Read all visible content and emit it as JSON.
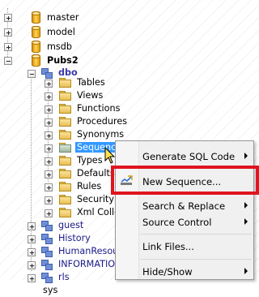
{
  "tree": {
    "databases": [
      {
        "label": "master",
        "expanded": false
      },
      {
        "label": "model",
        "expanded": false
      },
      {
        "label": "msdb",
        "expanded": false
      },
      {
        "label": "Pubs2",
        "expanded": true
      }
    ],
    "schema": "dbo",
    "folders": [
      "Tables",
      "Views",
      "Functions",
      "Procedures",
      "Synonyms",
      "Sequences",
      "Types",
      "Defaults",
      "Rules",
      "Security Po",
      "Xml Collect"
    ],
    "selected_folder": "Sequences",
    "other_schemas": [
      "guest",
      "History",
      "HumanResour",
      "INFORMATION",
      "rls",
      "sys"
    ]
  },
  "context_menu": {
    "items": [
      {
        "label": "Generate SQL Code",
        "submenu": true
      },
      {
        "label": "New Sequence...",
        "submenu": false,
        "icon": "new-sequence-icon"
      },
      {
        "label": "Search & Replace",
        "submenu": true
      },
      {
        "label": "Source Control",
        "submenu": true
      },
      {
        "label": "Link Files...",
        "submenu": false
      },
      {
        "label": "Hide/Show",
        "submenu": true
      }
    ]
  },
  "colors": {
    "selection": "#3399ff",
    "highlight_border": "#e0141e",
    "menu_bg": "#f0f0f0"
  }
}
